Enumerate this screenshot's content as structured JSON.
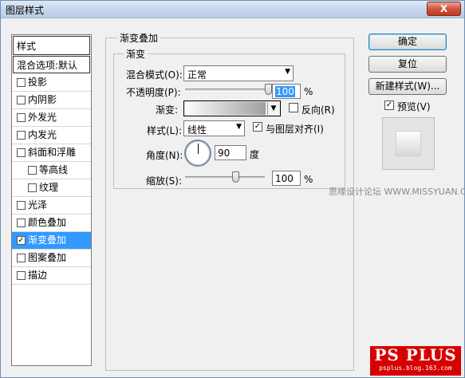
{
  "window": {
    "title": "图层样式",
    "close_label": "X"
  },
  "stylelist": {
    "header": "样式",
    "blend": "混合选项:默认",
    "items": [
      {
        "label": "投影",
        "checked": false,
        "sub": false
      },
      {
        "label": "内阴影",
        "checked": false,
        "sub": false
      },
      {
        "label": "外发光",
        "checked": false,
        "sub": false
      },
      {
        "label": "内发光",
        "checked": false,
        "sub": false
      },
      {
        "label": "斜面和浮雕",
        "checked": false,
        "sub": false
      },
      {
        "label": "等高线",
        "checked": false,
        "sub": true
      },
      {
        "label": "纹理",
        "checked": false,
        "sub": true
      },
      {
        "label": "光泽",
        "checked": false,
        "sub": false
      },
      {
        "label": "颜色叠加",
        "checked": false,
        "sub": false
      },
      {
        "label": "渐变叠加",
        "checked": true,
        "sub": false,
        "selected": true
      },
      {
        "label": "图案叠加",
        "checked": false,
        "sub": false
      },
      {
        "label": "描边",
        "checked": false,
        "sub": false
      }
    ]
  },
  "panel": {
    "group_title": "渐变叠加",
    "subgroup_title": "渐变",
    "blend_mode_label": "混合模式(O):",
    "blend_mode_value": "正常",
    "opacity_label": "不透明度(P):",
    "opacity_value": "100",
    "opacity_unit": "%",
    "opacity_level": 1.0,
    "gradient_label": "渐变:",
    "reverse_label": "反向(R)",
    "reverse_checked": false,
    "style_label": "样式(L):",
    "style_value": "线性",
    "align_label": "与图层对齐(I)",
    "align_checked": true,
    "angle_label": "角度(N):",
    "angle_value": "90",
    "angle_unit": "度",
    "scale_label": "缩放(S):",
    "scale_value": "100",
    "scale_unit": "%",
    "scale_level": 0.5
  },
  "buttons": {
    "ok": "确定",
    "reset": "复位",
    "new_style": "新建样式(W)...",
    "preview_label": "预览(V)",
    "preview_checked": true
  },
  "watermark": "思缘设计论坛 WWW.MISSYUAN.COM",
  "logo": {
    "title": "PS PLUS",
    "url": "psplus.blog.163.com"
  },
  "colors": {
    "selection": "#3399ff",
    "logo_bg": "#d60000"
  }
}
